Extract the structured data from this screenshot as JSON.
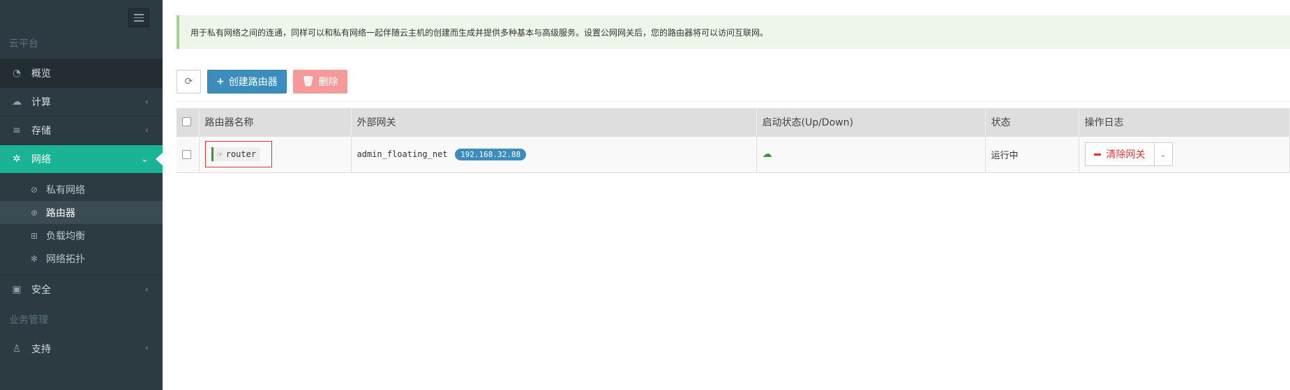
{
  "sidebar": {
    "section_platform": "云平台",
    "section_business": "业务管理",
    "items": [
      {
        "label": "概览",
        "icon": "dashboard-icon"
      },
      {
        "label": "计算",
        "icon": "cloud-icon"
      },
      {
        "label": "存储",
        "icon": "database-icon"
      },
      {
        "label": "网络",
        "icon": "network-icon"
      },
      {
        "label": "安全",
        "icon": "briefcase-icon"
      },
      {
        "label": "支持",
        "icon": "support-icon"
      }
    ],
    "network_sub": [
      {
        "label": "私有网络",
        "icon": "rss-icon"
      },
      {
        "label": "路由器",
        "icon": "globe-icon"
      },
      {
        "label": "负载均衡",
        "icon": "sitemap-icon"
      },
      {
        "label": "网络拓扑",
        "icon": "asterisk-icon"
      }
    ]
  },
  "notice": {
    "text": "用于私有网络之间的连通，同样可以和私有网络一起伴随云主机的创建而生成并提供多种基本与高级服务。设置公网网关后，您的路由器将可以访问互联网。"
  },
  "toolbar": {
    "refresh_icon": "refresh-icon",
    "create_label": "创建路由器",
    "delete_label": "删除"
  },
  "table": {
    "columns": [
      "路由器名称",
      "外部网关",
      "启动状态(Up/Down)",
      "状态",
      "操作日志"
    ],
    "rows": [
      {
        "name": "router",
        "gateway_net": "admin_floating_net",
        "gateway_ip": "192.168.32.88",
        "admin_state_icon": "cloud-upload-icon",
        "status": "运行中",
        "action_label": "清除网关"
      }
    ]
  },
  "colors": {
    "sidebar_bg": "#2c3b41",
    "active_item": "#1ab394",
    "primary_button": "#3c8dbc",
    "danger_button": "#f59a9a",
    "notice_border": "#a6d486",
    "action_red": "#dd3333"
  }
}
